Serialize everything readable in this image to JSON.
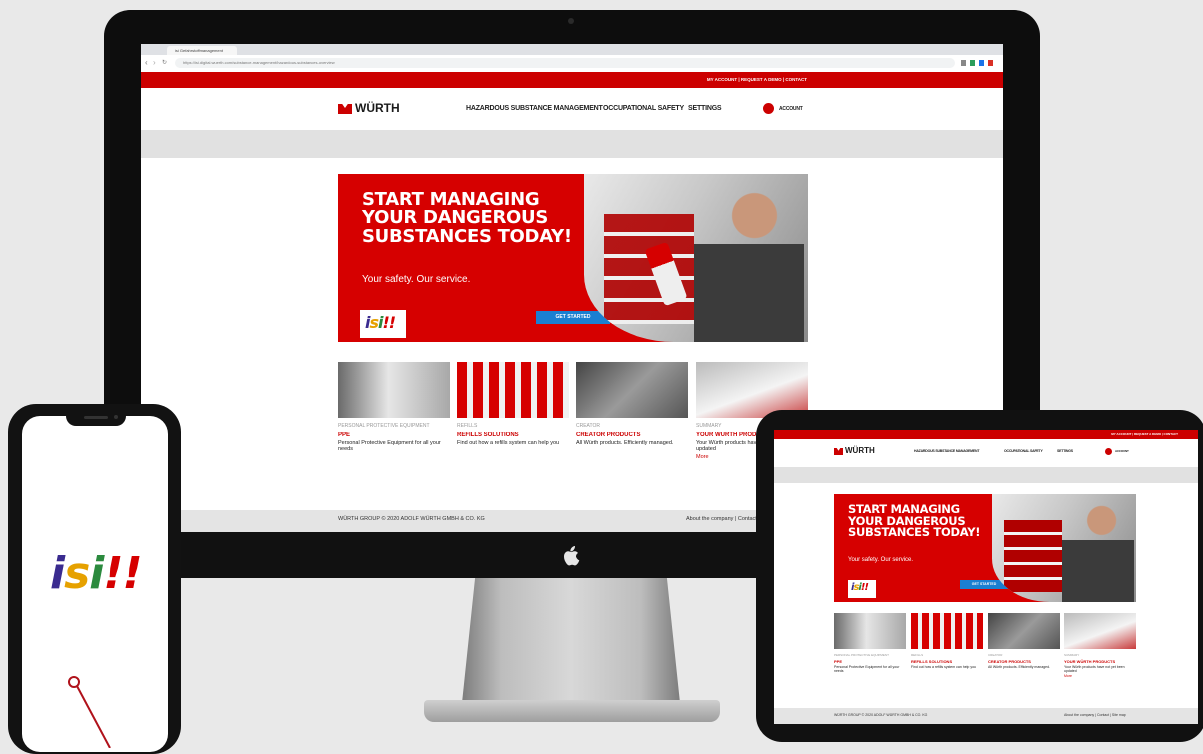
{
  "browser": {
    "tab_title": "isi Gefahrstoffmanagement",
    "url": "https://isi.digital.wuerth.com/substance-management/hazardous-substances-overview"
  },
  "site": {
    "topbar_links": "MY ACCOUNT  |  REQUEST A DEMO  |  CONTACT",
    "logo": "WÜRTH",
    "nav": [
      "HAZARDOUS SUBSTANCE MANAGEMENT",
      "OCCUPATIONAL SAFETY",
      "SETTINGS"
    ],
    "account_label": "ACCOUNT",
    "hero": {
      "title": "START MANAGING\nYOUR DANGEROUS\nSUBSTANCES TODAY!",
      "subtitle": "Your safety. Our service.",
      "button": "GET STARTED",
      "badge": "isi!!"
    },
    "cards": [
      {
        "category": "PERSONAL PROTECTIVE EQUIPMENT",
        "title": "PPE",
        "desc": "Personal Protective Equipment for all your needs"
      },
      {
        "category": "REFILLS",
        "title": "REFILLS SOLUTIONS",
        "desc": "Find out how a refills system can help you"
      },
      {
        "category": "CREATOR",
        "title": "CREATOR PRODUCTS",
        "desc": "All Würth products. Efficiently managed."
      },
      {
        "category": "SUMMARY",
        "title": "YOUR WÜRTH PRODUCTS",
        "desc": "Your Würth products have not yet been updated",
        "more": "More"
      }
    ],
    "footer_left": "WÜRTH GROUP  © 2020 ADOLF WÜRTH GMBH & CO. KG",
    "footer_right": "About the company  |  Contact  |  Site map"
  },
  "phone": {
    "logo": "isi!!"
  },
  "colors": {
    "brand_red": "#d60000",
    "button_blue": "#1a7fd1",
    "background": "#e9e9e9"
  }
}
